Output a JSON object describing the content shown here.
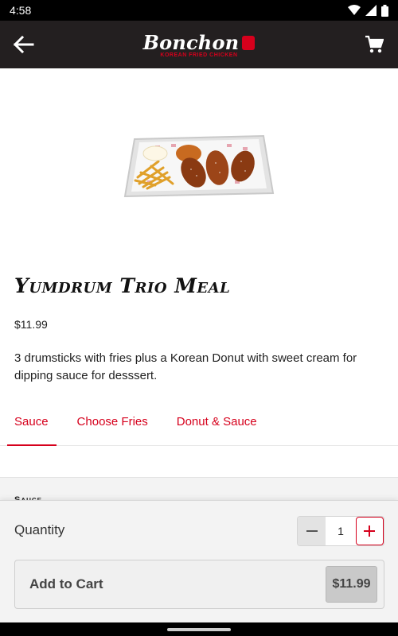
{
  "status_bar": {
    "time": "4:58",
    "icons": [
      "wifi-icon",
      "signal-icon",
      "battery-icon"
    ]
  },
  "header": {
    "back_icon": "arrow-left-icon",
    "logo_text": "Bonchon",
    "logo_tagline": "KOREAN FRIED CHICKEN",
    "cart_icon": "shopping-cart-icon"
  },
  "product": {
    "image_icon": "meal-tray-image",
    "title": "Yumdrum Trio Meal",
    "price": "$11.99",
    "description": "3 drumsticks with fries plus a Korean Donut with sweet cream for dipping sauce for desssert."
  },
  "tabs": [
    {
      "label": "Sauce",
      "active": true
    },
    {
      "label": "Choose Fries",
      "active": false
    },
    {
      "label": "Donut & Sauce",
      "active": false
    }
  ],
  "section": {
    "label": "Sauce"
  },
  "footer": {
    "quantity_label": "Quantity",
    "quantity_value": "1",
    "add_to_cart_label": "Add to Cart",
    "add_to_cart_price": "$11.99"
  },
  "colors": {
    "brand_red": "#d6001c",
    "app_bar": "#231f20"
  }
}
